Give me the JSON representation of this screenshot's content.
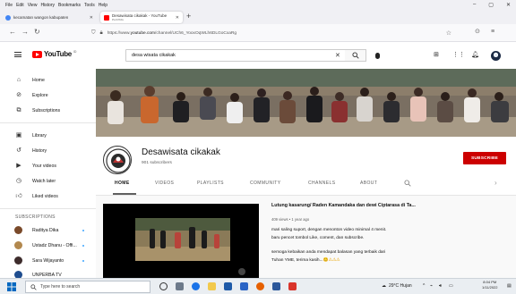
{
  "browser": {
    "menu": [
      "File",
      "Edit",
      "View",
      "History",
      "Bookmarks",
      "Tools",
      "Help"
    ],
    "tabs": [
      {
        "title": "kecamatan wangon kabupaten",
        "active": false
      },
      {
        "title": "Desawisata cikakak - YouTube",
        "subtitle": "PLAYING",
        "active": true
      }
    ],
    "url_prefix": "https://www.",
    "url_domain": "youtube.com",
    "url_path": "/channel/UCh6_YooxOqWLh6DLGoCxaRg"
  },
  "youtube": {
    "logo_text": "YouTube",
    "logo_suffix": "ID",
    "search_value": "desa wisata cikakak"
  },
  "sidebar": {
    "items": [
      {
        "label": "Home",
        "icon": "home-icon"
      },
      {
        "label": "Explore",
        "icon": "explore-icon"
      },
      {
        "label": "Subscriptions",
        "icon": "subscriptions-icon"
      },
      {
        "label": "Library",
        "icon": "library-icon"
      },
      {
        "label": "History",
        "icon": "history-icon"
      },
      {
        "label": "Your videos",
        "icon": "your-videos-icon"
      },
      {
        "label": "Watch later",
        "icon": "watch-later-icon"
      },
      {
        "label": "Liked videos",
        "icon": "liked-videos-icon"
      }
    ],
    "subscriptions_heading": "SUBSCRIPTIONS",
    "subscriptions": [
      {
        "name": "Raditya Dika",
        "color": "#7a4a2a"
      },
      {
        "name": "Ustadz Dhanu - Offi...",
        "color": "#b2884e"
      },
      {
        "name": "Sara Wijayanto",
        "color": "#3d2c2c"
      },
      {
        "name": "UNPERBA TV",
        "color": "#1f4d8f"
      }
    ]
  },
  "channel": {
    "name": "Desawisata cikakak",
    "subscribers": "901 subscribers",
    "subscribe_label": "SUBSCRIBE",
    "tabs": [
      "HOME",
      "VIDEOS",
      "PLAYLISTS",
      "COMMUNITY",
      "CHANNELS",
      "ABOUT"
    ]
  },
  "featured_video": {
    "title": "Lutung kasarung/ Raden Kamandaka dan dewi Ciptarasa di Ta...",
    "meta": "409 views • 1 year ago",
    "description": [
      "mari saling suport, dengan menonton video minimal 4 menit.",
      "baru pencet tombol Like, coment, dan subscribe.",
      "semoga kebaikan anda mendapat balasan yang terbaik dari",
      "Tuhan YME, terima kasih..."
    ]
  },
  "taskbar": {
    "search_placeholder": "Type here to search",
    "weather": "29°C Hujan",
    "time": "8:04 PM",
    "date": "1/11/2022"
  },
  "colors": {
    "accent_red": "#cc0000",
    "youtube_red": "#ff0000"
  }
}
